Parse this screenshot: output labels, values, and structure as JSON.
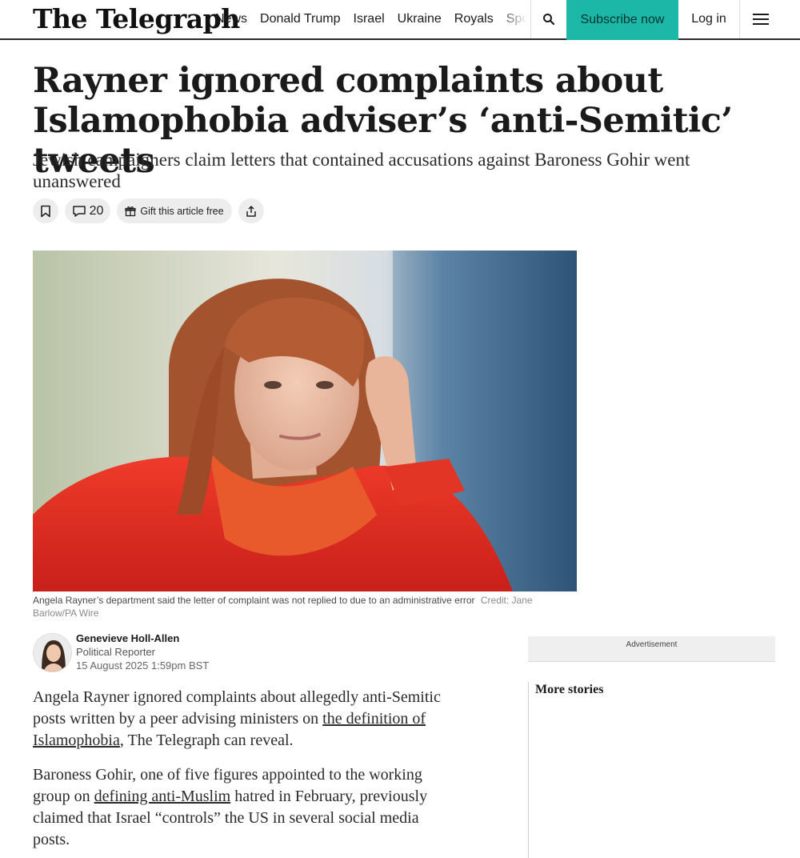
{
  "header": {
    "logo": "The Telegraph",
    "nav": [
      "News",
      "Donald Trump",
      "Israel",
      "Ukraine",
      "Royals",
      "Sport"
    ],
    "subscribe_label": "Subscribe now",
    "login_label": "Log in",
    "accent_color": "#1cb7a6"
  },
  "article": {
    "headline": "Rayner ignored complaints about Islamophobia adviser’s ‘anti-Semitic’ tweets",
    "standfirst": "Jewish campaigners claim letters that contained accusations against Baroness Gohir went unanswered",
    "comment_count": "20",
    "gift_label": "Gift this article free",
    "caption": "Angela Rayner’s department said the letter of complaint was not replied to due to an administrative error",
    "credit": "Credit: Jane Barlow/PA Wire",
    "author": {
      "name": "Genevieve Holl-Allen",
      "role": "Political Reporter",
      "date": "15 August 2025 1:59pm BST"
    },
    "para1": {
      "before": "Angela Rayner ignored complaints about allegedly anti-Semitic posts written by a peer advising ministers on ",
      "link": "the definition of Islamophobia",
      "after": ", The Telegraph can reveal."
    },
    "para2": {
      "before": "Baroness Gohir, one of five figures appointed to the working group on ",
      "link": "defining anti-Muslim",
      "after": " hatred in February, previously claimed that Israel “controls” the US in several social media posts."
    }
  },
  "sidebar": {
    "ad_label": "Advertisement",
    "more_stories": "More stories"
  }
}
